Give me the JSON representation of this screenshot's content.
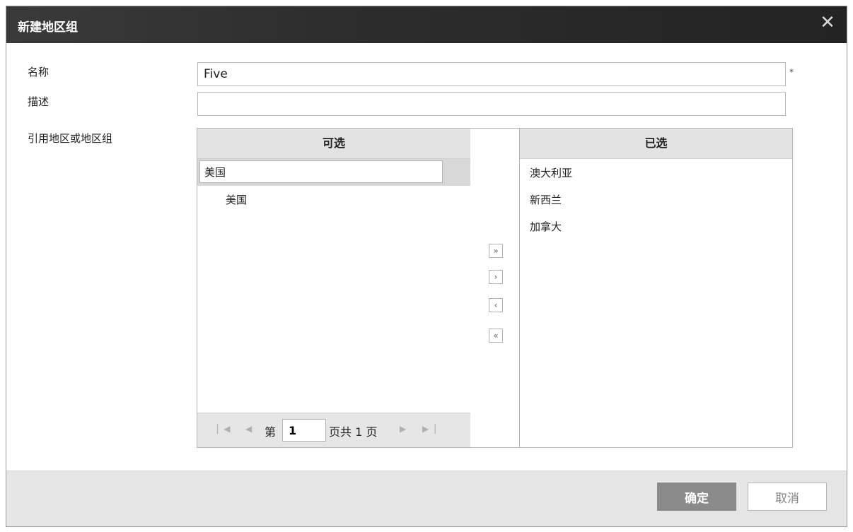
{
  "dialog": {
    "title": "新建地区组",
    "close_icon": "close-icon"
  },
  "form": {
    "name_label": "名称",
    "name_value": "Five",
    "required_mark": "*",
    "desc_label": "描述",
    "desc_value": "",
    "ref_label": "引用地区或地区组"
  },
  "available": {
    "header": "可选",
    "search_value": "美国",
    "items": [
      "美国"
    ]
  },
  "pager": {
    "first_icon": "first-page-icon",
    "prev_icon": "prev-page-icon",
    "page_prefix": "第",
    "page_value": "1",
    "page_suffix": "页共 1 页",
    "next_icon": "next-page-icon",
    "last_icon": "last-page-icon"
  },
  "move_buttons": {
    "add_all": "»",
    "add_one": "›",
    "remove_one": "‹",
    "remove_all": "«"
  },
  "selected": {
    "header": "已选",
    "items": [
      "澳大利亚",
      "新西兰",
      "加拿大"
    ]
  },
  "footer": {
    "ok_label": "确定",
    "cancel_label": "取消"
  },
  "colors": {
    "titlebar": "#2d2d2d",
    "ok_button": "#8a8a8a",
    "panel_header": "#e3e3e3"
  }
}
